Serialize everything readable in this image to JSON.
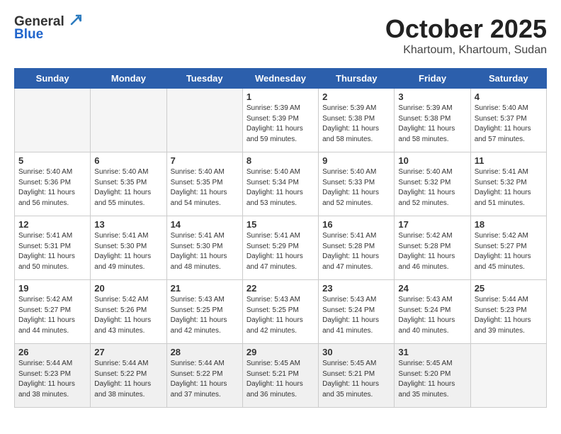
{
  "header": {
    "logo_line1": "General",
    "logo_line2": "Blue",
    "month": "October 2025",
    "location": "Khartoum, Khartoum, Sudan"
  },
  "weekdays": [
    "Sunday",
    "Monday",
    "Tuesday",
    "Wednesday",
    "Thursday",
    "Friday",
    "Saturday"
  ],
  "weeks": [
    [
      {
        "day": "",
        "info": ""
      },
      {
        "day": "",
        "info": ""
      },
      {
        "day": "",
        "info": ""
      },
      {
        "day": "1",
        "info": "Sunrise: 5:39 AM\nSunset: 5:39 PM\nDaylight: 11 hours\nand 59 minutes."
      },
      {
        "day": "2",
        "info": "Sunrise: 5:39 AM\nSunset: 5:38 PM\nDaylight: 11 hours\nand 58 minutes."
      },
      {
        "day": "3",
        "info": "Sunrise: 5:39 AM\nSunset: 5:38 PM\nDaylight: 11 hours\nand 58 minutes."
      },
      {
        "day": "4",
        "info": "Sunrise: 5:40 AM\nSunset: 5:37 PM\nDaylight: 11 hours\nand 57 minutes."
      }
    ],
    [
      {
        "day": "5",
        "info": "Sunrise: 5:40 AM\nSunset: 5:36 PM\nDaylight: 11 hours\nand 56 minutes."
      },
      {
        "day": "6",
        "info": "Sunrise: 5:40 AM\nSunset: 5:35 PM\nDaylight: 11 hours\nand 55 minutes."
      },
      {
        "day": "7",
        "info": "Sunrise: 5:40 AM\nSunset: 5:35 PM\nDaylight: 11 hours\nand 54 minutes."
      },
      {
        "day": "8",
        "info": "Sunrise: 5:40 AM\nSunset: 5:34 PM\nDaylight: 11 hours\nand 53 minutes."
      },
      {
        "day": "9",
        "info": "Sunrise: 5:40 AM\nSunset: 5:33 PM\nDaylight: 11 hours\nand 52 minutes."
      },
      {
        "day": "10",
        "info": "Sunrise: 5:40 AM\nSunset: 5:32 PM\nDaylight: 11 hours\nand 52 minutes."
      },
      {
        "day": "11",
        "info": "Sunrise: 5:41 AM\nSunset: 5:32 PM\nDaylight: 11 hours\nand 51 minutes."
      }
    ],
    [
      {
        "day": "12",
        "info": "Sunrise: 5:41 AM\nSunset: 5:31 PM\nDaylight: 11 hours\nand 50 minutes."
      },
      {
        "day": "13",
        "info": "Sunrise: 5:41 AM\nSunset: 5:30 PM\nDaylight: 11 hours\nand 49 minutes."
      },
      {
        "day": "14",
        "info": "Sunrise: 5:41 AM\nSunset: 5:30 PM\nDaylight: 11 hours\nand 48 minutes."
      },
      {
        "day": "15",
        "info": "Sunrise: 5:41 AM\nSunset: 5:29 PM\nDaylight: 11 hours\nand 47 minutes."
      },
      {
        "day": "16",
        "info": "Sunrise: 5:41 AM\nSunset: 5:28 PM\nDaylight: 11 hours\nand 47 minutes."
      },
      {
        "day": "17",
        "info": "Sunrise: 5:42 AM\nSunset: 5:28 PM\nDaylight: 11 hours\nand 46 minutes."
      },
      {
        "day": "18",
        "info": "Sunrise: 5:42 AM\nSunset: 5:27 PM\nDaylight: 11 hours\nand 45 minutes."
      }
    ],
    [
      {
        "day": "19",
        "info": "Sunrise: 5:42 AM\nSunset: 5:27 PM\nDaylight: 11 hours\nand 44 minutes."
      },
      {
        "day": "20",
        "info": "Sunrise: 5:42 AM\nSunset: 5:26 PM\nDaylight: 11 hours\nand 43 minutes."
      },
      {
        "day": "21",
        "info": "Sunrise: 5:43 AM\nSunset: 5:25 PM\nDaylight: 11 hours\nand 42 minutes."
      },
      {
        "day": "22",
        "info": "Sunrise: 5:43 AM\nSunset: 5:25 PM\nDaylight: 11 hours\nand 42 minutes."
      },
      {
        "day": "23",
        "info": "Sunrise: 5:43 AM\nSunset: 5:24 PM\nDaylight: 11 hours\nand 41 minutes."
      },
      {
        "day": "24",
        "info": "Sunrise: 5:43 AM\nSunset: 5:24 PM\nDaylight: 11 hours\nand 40 minutes."
      },
      {
        "day": "25",
        "info": "Sunrise: 5:44 AM\nSunset: 5:23 PM\nDaylight: 11 hours\nand 39 minutes."
      }
    ],
    [
      {
        "day": "26",
        "info": "Sunrise: 5:44 AM\nSunset: 5:23 PM\nDaylight: 11 hours\nand 38 minutes."
      },
      {
        "day": "27",
        "info": "Sunrise: 5:44 AM\nSunset: 5:22 PM\nDaylight: 11 hours\nand 38 minutes."
      },
      {
        "day": "28",
        "info": "Sunrise: 5:44 AM\nSunset: 5:22 PM\nDaylight: 11 hours\nand 37 minutes."
      },
      {
        "day": "29",
        "info": "Sunrise: 5:45 AM\nSunset: 5:21 PM\nDaylight: 11 hours\nand 36 minutes."
      },
      {
        "day": "30",
        "info": "Sunrise: 5:45 AM\nSunset: 5:21 PM\nDaylight: 11 hours\nand 35 minutes."
      },
      {
        "day": "31",
        "info": "Sunrise: 5:45 AM\nSunset: 5:20 PM\nDaylight: 11 hours\nand 35 minutes."
      },
      {
        "day": "",
        "info": ""
      }
    ]
  ]
}
